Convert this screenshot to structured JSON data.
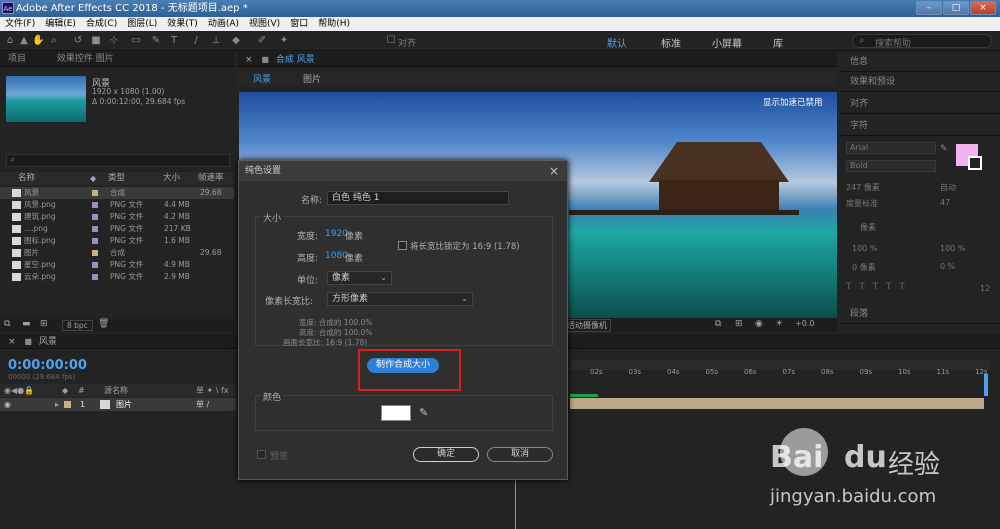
{
  "titlebar": {
    "app_icon": "Ae",
    "title": "Adobe After Effects CC 2018 - 无标题项目.aep *",
    "minimize": "–",
    "maximize": "□",
    "close": "×"
  },
  "menubar": [
    "文件(F)",
    "编辑(E)",
    "合成(C)",
    "图层(L)",
    "效果(T)",
    "动画(A)",
    "视图(V)",
    "窗口",
    "帮助(H)"
  ],
  "toolbar": {
    "snap_label": "对齐",
    "workspaces": [
      "默认",
      "标准",
      "小屏幕",
      "库"
    ],
    "search_help": "搜索帮助",
    "icons": [
      "home-icon",
      "select-icon",
      "hand-icon",
      "zoom-icon",
      "rotate-icon",
      "camera-icon",
      "pan-icon",
      "mask-icon",
      "pen-icon",
      "text-icon",
      "brush-icon",
      "clone-stamp-icon",
      "eraser-icon",
      "roto-brush-icon",
      "puppet-icon"
    ]
  },
  "project": {
    "tabs": [
      "项目",
      "效果控件 图片"
    ],
    "comp_name": "风景",
    "comp_info_1": "1920 x 1080 (1.00)",
    "comp_info_2": "Δ 0:00:12:00, 29.684 fps",
    "search_placeholder": "",
    "columns": [
      "名称",
      "类型",
      "大小",
      "帧速率"
    ],
    "rows": [
      {
        "name": "风景",
        "type": "合成",
        "size": "",
        "fps": "29.68",
        "label_color": "#c8b27a"
      },
      {
        "name": "风景.png",
        "type": "PNG 文件",
        "size": "4.4 MB",
        "fps": "",
        "label_color": "#9a8fbf"
      },
      {
        "name": "建筑.png",
        "type": "PNG 文件",
        "size": "4.2 MB",
        "fps": "",
        "label_color": "#9a8fbf"
      },
      {
        "name": "....png",
        "type": "PNG 文件",
        "size": "217 KB",
        "fps": "",
        "label_color": "#9a8fbf"
      },
      {
        "name": "图标.png",
        "type": "PNG 文件",
        "size": "1.6 MB",
        "fps": "",
        "label_color": "#9a8fbf"
      },
      {
        "name": "图片",
        "type": "合成",
        "size": "",
        "fps": "29.68",
        "label_color": "#c8b27a"
      },
      {
        "name": "星空.png",
        "type": "PNG 文件",
        "size": "4.9 MB",
        "fps": "",
        "label_color": "#9a8fbf"
      },
      {
        "name": "云朵.png",
        "type": "PNG 文件",
        "size": "2.9 MB",
        "fps": "",
        "label_color": "#9a8fbf"
      }
    ],
    "bpc": "8 bpc"
  },
  "viewer": {
    "tab_title": "合成 风景",
    "sub_tabs": [
      "风景",
      "图片"
    ],
    "overlay_text": "显示加速已禁用",
    "camera_label": "活动摄像机",
    "offset": "+0.0"
  },
  "right_panels": [
    "信息",
    "效果和预设",
    "对齐",
    "字符",
    "段落"
  ],
  "character": {
    "font": "Arial",
    "style": "Bold",
    "size": "247 像素",
    "leading": "自动",
    "kerning": "度量标准",
    "tracking": "47",
    "unit": "像素",
    "scale_v": "100 %",
    "scale_h": "100 %",
    "baseline": "0 像素",
    "tsume": "0 %",
    "tsume2": "12"
  },
  "timeline": {
    "comp_tab": "风景",
    "timecode": "0:00:00:00",
    "fps_note": "00000 (29.684 fps)",
    "layer_header": "源名称",
    "layer_num": "1",
    "layer_name": "图片",
    "ticks": [
      "02s",
      "03s",
      "04s",
      "05s",
      "06s",
      "07s",
      "08s",
      "09s",
      "10s",
      "11s",
      "12s"
    ]
  },
  "dialog": {
    "title": "纯色设置",
    "name_label": "名称:",
    "name_value": "白色 纯色 1",
    "size_group": "大小",
    "width_label": "宽度:",
    "width_value": "1920",
    "width_unit": "像素",
    "height_label": "高度:",
    "height_value": "1080",
    "height_unit": "像素",
    "lock_label": "将长宽比锁定为 16:9 (1.78)",
    "units_label": "单位:",
    "units_value": "像素",
    "par_label": "像素长宽比:",
    "par_value": "方形像素",
    "info_w": "宽度: 合成的 100.0%",
    "info_h": "高度: 合成的 100.0%",
    "info_frame": "画面长宽比: 16:9 (1.78)",
    "make_comp_size": "制作合成大小",
    "color_group": "颜色",
    "color_value": "#ffffff",
    "preview_label": "预览",
    "ok": "确定",
    "cancel": "取消"
  },
  "watermark": {
    "brand": "Bai",
    "brand2": "du",
    "brand3": "经验",
    "url": "jingyan.baidu.com"
  }
}
